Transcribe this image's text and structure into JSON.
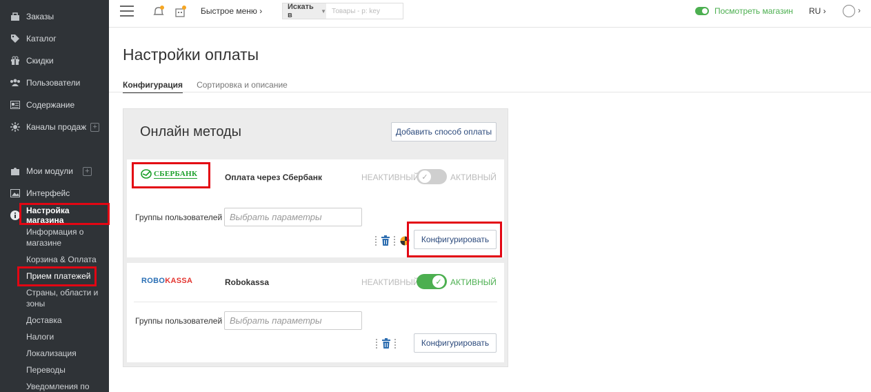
{
  "sidebar": {
    "items": [
      {
        "label": "Заказы",
        "icon": "orders-icon"
      },
      {
        "label": "Каталог",
        "icon": "tag-icon"
      },
      {
        "label": "Скидки",
        "icon": "gift-icon"
      },
      {
        "label": "Пользователи",
        "icon": "users-icon"
      },
      {
        "label": "Содержание",
        "icon": "content-icon"
      },
      {
        "label": "Каналы продаж",
        "icon": "channels-icon"
      },
      {
        "label": "Мои модули",
        "icon": "puzzle-icon"
      },
      {
        "label": "Интерфейс",
        "icon": "image-icon"
      },
      {
        "label": "Настройка магазина",
        "icon": "info-icon"
      }
    ],
    "sub_items": [
      "Информация о магазине",
      "Корзина & Оплата",
      "Прием платежей",
      "Страны, области и зоны",
      "Доставка",
      "Налоги",
      "Локализация",
      "Переводы",
      "Уведомления по"
    ]
  },
  "topbar": {
    "quick_menu": "Быстрое меню",
    "search_scope": "Искать в",
    "search_placeholder": "Товары - p: key",
    "view_store": "Посмотреть магазин",
    "lang": "RU"
  },
  "page": {
    "title": "Настройки оплаты",
    "tabs": [
      "Конфигурация",
      "Сортировка и описание"
    ]
  },
  "panel": {
    "title": "Онлайн методы",
    "add_button": "Добавить способ оплаты",
    "inactive_label": "НЕАКТИВНЫЙ",
    "active_label": "АКТИВНЫЙ",
    "groups_label": "Группы пользователей",
    "groups_placeholder": "Выбрать параметры",
    "configure_label": "Конфигурировать",
    "methods": [
      {
        "name": "Оплата через Сбербанк",
        "logo": "СБЕРБАНК",
        "active": false
      },
      {
        "name": "Robokassa",
        "logo_a": "ROBO",
        "logo_b": "KASSA",
        "active": true
      }
    ]
  },
  "colors": {
    "sidebar_bg": "#2f3337",
    "accent_green": "#4caf50",
    "highlight_red": "#e30613",
    "sber_green": "#1a9f29",
    "robo_blue": "#2a6fb5",
    "robo_red": "#e3342f"
  }
}
